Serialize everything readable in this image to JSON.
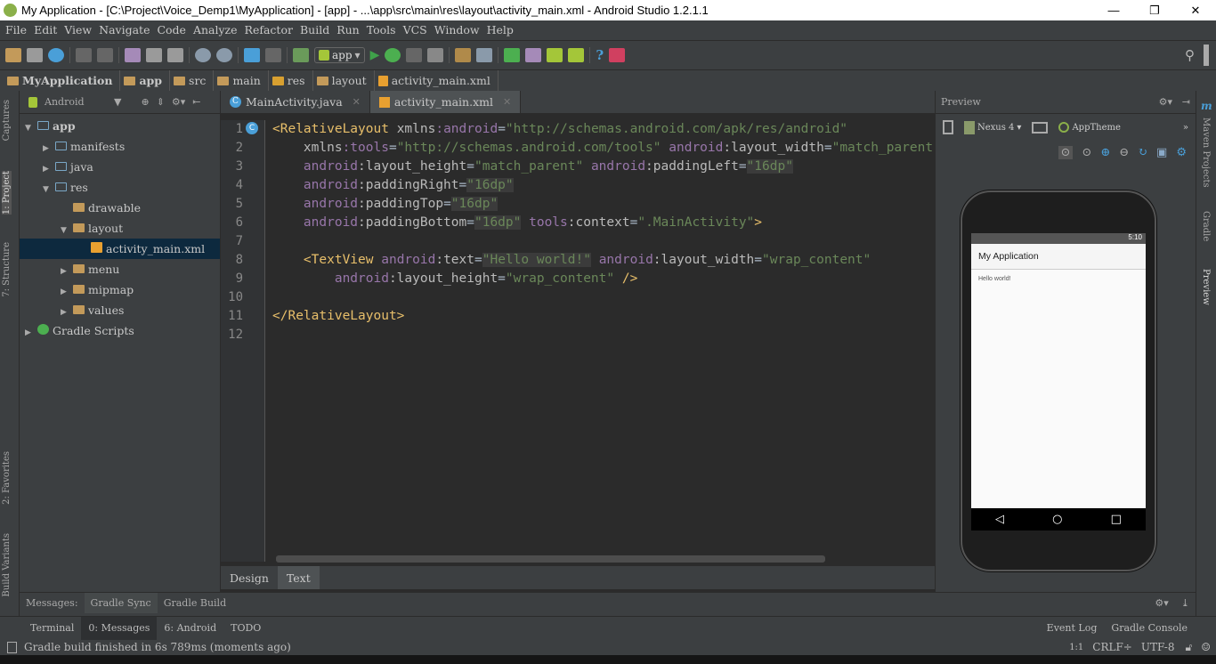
{
  "window": {
    "title": "My Application - [C:\\Project\\Voice_Demp1\\MyApplication] - [app] - ...\\app\\src\\main\\res\\layout\\activity_main.xml - Android Studio 1.2.1.1",
    "min": "—",
    "max": "❐",
    "close": "✕"
  },
  "menu": [
    "File",
    "Edit",
    "View",
    "Navigate",
    "Code",
    "Analyze",
    "Refactor",
    "Build",
    "Run",
    "Tools",
    "VCS",
    "Window",
    "Help"
  ],
  "toolbar": {
    "run_config": "app"
  },
  "breadcrumb": [
    "MyApplication",
    "app",
    "src",
    "main",
    "res",
    "layout",
    "activity_main.xml"
  ],
  "left_tabs": [
    "Captures",
    "1: Project",
    "7: Structure",
    "2: Favorites",
    "Build Variants"
  ],
  "project": {
    "view": "Android",
    "tree": [
      {
        "label": "app",
        "depth": 0,
        "arrow": "▼"
      },
      {
        "label": "manifests",
        "depth": 1,
        "arrow": "▶"
      },
      {
        "label": "java",
        "depth": 1,
        "arrow": "▶"
      },
      {
        "label": "res",
        "depth": 1,
        "arrow": "▼"
      },
      {
        "label": "drawable",
        "depth": 2,
        "arrow": ""
      },
      {
        "label": "layout",
        "depth": 2,
        "arrow": "▼"
      },
      {
        "label": "activity_main.xml",
        "depth": 3,
        "arrow": "",
        "selected": true
      },
      {
        "label": "menu",
        "depth": 2,
        "arrow": "▶"
      },
      {
        "label": "mipmap",
        "depth": 2,
        "arrow": "▶"
      },
      {
        "label": "values",
        "depth": 2,
        "arrow": "▶"
      },
      {
        "label": "Gradle Scripts",
        "depth": 0,
        "arrow": "▶"
      }
    ]
  },
  "editor": {
    "tabs": [
      {
        "label": "MainActivity.java",
        "active": false
      },
      {
        "label": "activity_main.xml",
        "active": true
      }
    ],
    "line_numbers": [
      "1",
      "2",
      "3",
      "4",
      "5",
      "6",
      "7",
      "8",
      "9",
      "10",
      "11",
      "12"
    ],
    "bottom_tabs": [
      "Design",
      "Text"
    ],
    "active_bottom_tab": "Text"
  },
  "preview": {
    "title": "Preview",
    "device": "Nexus 4",
    "theme": "AppTheme",
    "phone_time": "5:10",
    "app_title": "My Application",
    "content": "Hello world!"
  },
  "right_tabs": [
    "Maven Projects",
    "Gradle",
    "Preview"
  ],
  "messages": {
    "label": "Messages:",
    "tabs": [
      "Gradle Sync",
      "Gradle Build"
    ]
  },
  "tool_windows": {
    "left": [
      "Terminal",
      "0: Messages",
      "6: Android",
      "TODO"
    ],
    "right": [
      "Event Log",
      "Gradle Console"
    ]
  },
  "status": {
    "message": "Gradle build finished in 6s 789ms (moments ago)",
    "position": "1:1",
    "line_sep": "CRLF÷",
    "encoding": "UTF-8"
  }
}
